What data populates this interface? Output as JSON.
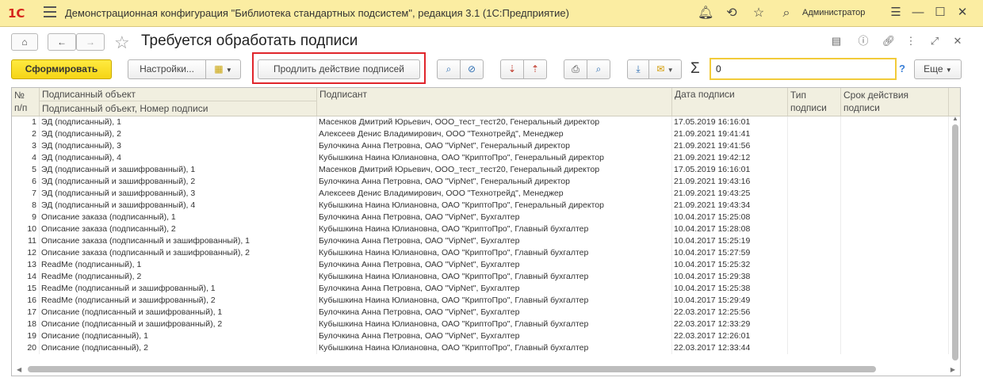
{
  "app": {
    "logo": "1С",
    "title": "Демонстрационная конфигурация \"Библиотека стандартных подсистем\", редакция 3.1  (1С:Предприятие)",
    "user": "Администратор"
  },
  "form": {
    "title": "Требуется обработать подписи"
  },
  "toolbar": {
    "generate": "Сформировать",
    "settings": "Настройки...",
    "extend": "Продлить действие подписей",
    "search_value": "0",
    "help": "?",
    "more": "Еще"
  },
  "columns": {
    "num": "№",
    "num2": "п/п",
    "object": "Подписанный объект",
    "object2": "Подписанный объект, Номер подписи",
    "signer": "Подписант",
    "date": "Дата подписи",
    "type": "Тип",
    "type2": "подписи",
    "expiry": "Срок действия",
    "expiry2": "подписи"
  },
  "rows": [
    {
      "n": "1",
      "obj": "ЭД (подписанный), 1",
      "signer": "Масенков Дмитрий Юрьевич, ООО_тест_тест20, Генеральный директор",
      "date": "17.05.2019 16:16:01"
    },
    {
      "n": "2",
      "obj": "ЭД (подписанный), 2",
      "signer": "Алексеев Денис Владимирович, ООО \"Технотрейд\", Менеджер",
      "date": "21.09.2021 19:41:41"
    },
    {
      "n": "3",
      "obj": "ЭД (подписанный), 3",
      "signer": "Булочкина Анна Петровна, ОАО \"VipNet\", Генеральный директор",
      "date": "21.09.2021 19:41:56"
    },
    {
      "n": "4",
      "obj": "ЭД (подписанный), 4",
      "signer": "Кубышкина Наина Юлиановна, ОАО \"КриптоПро\", Генеральный директор",
      "date": "21.09.2021 19:42:12"
    },
    {
      "n": "5",
      "obj": "ЭД (подписанный и зашифрованный), 1",
      "signer": "Масенков Дмитрий Юрьевич, ООО_тест_тест20, Генеральный директор",
      "date": "17.05.2019 16:16:01"
    },
    {
      "n": "6",
      "obj": "ЭД (подписанный и зашифрованный), 2",
      "signer": "Булочкина Анна Петровна, ОАО \"VipNet\", Генеральный директор",
      "date": "21.09.2021 19:43:16"
    },
    {
      "n": "7",
      "obj": "ЭД (подписанный и зашифрованный), 3",
      "signer": "Алексеев Денис Владимирович, ООО \"Технотрейд\", Менеджер",
      "date": "21.09.2021 19:43:25"
    },
    {
      "n": "8",
      "obj": "ЭД (подписанный и зашифрованный), 4",
      "signer": "Кубышкина Наина Юлиановна, ОАО \"КриптоПро\", Генеральный директор",
      "date": "21.09.2021 19:43:34"
    },
    {
      "n": "9",
      "obj": "Описание заказа (подписанный), 1",
      "signer": "Булочкина Анна Петровна, ОАО \"VipNet\", Бухгалтер",
      "date": "10.04.2017 15:25:08"
    },
    {
      "n": "10",
      "obj": "Описание заказа (подписанный), 2",
      "signer": "Кубышкина Наина Юлиановна, ОАО \"КриптоПро\", Главный бухгалтер",
      "date": "10.04.2017 15:28:08"
    },
    {
      "n": "11",
      "obj": "Описание заказа (подписанный и зашифрованный), 1",
      "signer": "Булочкина Анна Петровна, ОАО \"VipNet\", Бухгалтер",
      "date": "10.04.2017 15:25:19"
    },
    {
      "n": "12",
      "obj": "Описание заказа (подписанный и зашифрованный), 2",
      "signer": "Кубышкина Наина Юлиановна, ОАО \"КриптоПро\", Главный бухгалтер",
      "date": "10.04.2017 15:27:59"
    },
    {
      "n": "13",
      "obj": "ReadMe (подписанный), 1",
      "signer": "Булочкина Анна Петровна, ОАО \"VipNet\", Бухгалтер",
      "date": "10.04.2017 15:25:32"
    },
    {
      "n": "14",
      "obj": "ReadMe (подписанный), 2",
      "signer": "Кубышкина Наина Юлиановна, ОАО \"КриптоПро\", Главный бухгалтер",
      "date": "10.04.2017 15:29:38"
    },
    {
      "n": "15",
      "obj": "ReadMe (подписанный и зашифрованный), 1",
      "signer": "Булочкина Анна Петровна, ОАО \"VipNet\", Бухгалтер",
      "date": "10.04.2017 15:25:38"
    },
    {
      "n": "16",
      "obj": "ReadMe (подписанный и зашифрованный), 2",
      "signer": "Кубышкина Наина Юлиановна, ОАО \"КриптоПро\", Главный бухгалтер",
      "date": "10.04.2017 15:29:49"
    },
    {
      "n": "17",
      "obj": "Описание (подписанный и зашифрованный), 1",
      "signer": "Булочкина Анна Петровна, ОАО \"VipNet\", Бухгалтер",
      "date": "22.03.2017 12:25:56"
    },
    {
      "n": "18",
      "obj": "Описание (подписанный и зашифрованный), 2",
      "signer": "Кубышкина Наина Юлиановна, ОАО \"КриптоПро\", Главный бухгалтер",
      "date": "22.03.2017 12:33:29"
    },
    {
      "n": "19",
      "obj": "Описание (подписанный), 1",
      "signer": "Булочкина Анна Петровна, ОАО \"VipNet\", Бухгалтер",
      "date": "22.03.2017 12:26:01"
    },
    {
      "n": "20",
      "obj": "Описание (подписанный), 2",
      "signer": "Кубышкина Наина Юлиановна, ОАО \"КриптоПро\", Главный бухгалтер",
      "date": "22.03.2017 12:33:44"
    }
  ]
}
